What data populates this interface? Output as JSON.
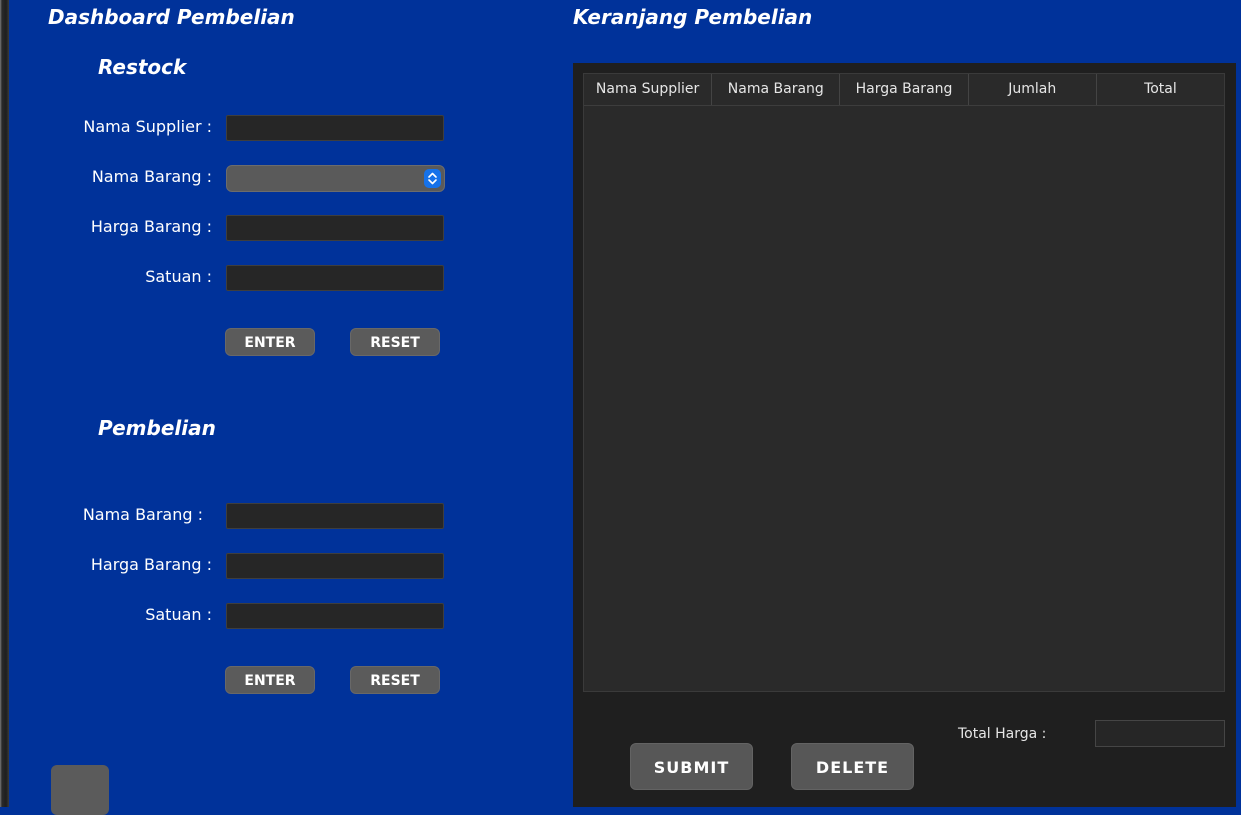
{
  "dashboard": {
    "title": "Dashboard Pembelian",
    "restock": {
      "title": "Restock",
      "supplier_label": "Nama Supplier :",
      "barang_label": "Nama Barang  :",
      "harga_label": "Harga Barang  :",
      "satuan_label": "Satuan :",
      "enter_label": "ENTER",
      "reset_label": "RESET"
    },
    "pembelian": {
      "title": "Pembelian",
      "barang_label": "Nama Barang :",
      "harga_label": "Harga Barang  :",
      "satuan_label": "Satuan :",
      "enter_label": "ENTER",
      "reset_label": "RESET"
    }
  },
  "cart": {
    "title": "Keranjang Pembelian",
    "columns": [
      "Nama Supplier",
      "Nama Barang",
      "Harga Barang",
      "Jumlah",
      "Total"
    ],
    "rows": [],
    "total_label": "Total Harga :",
    "total_value": "",
    "submit_label": "SUBMIT",
    "delete_label": "DELETE"
  },
  "icons": {
    "combo_arrow": "chevron-up-down-icon"
  },
  "colors": {
    "background": "#00329a",
    "panel": "#1f1f1f",
    "table": "#2a2a2a",
    "button": "#5b5b5b",
    "combo_arrow": "#1672ea"
  }
}
